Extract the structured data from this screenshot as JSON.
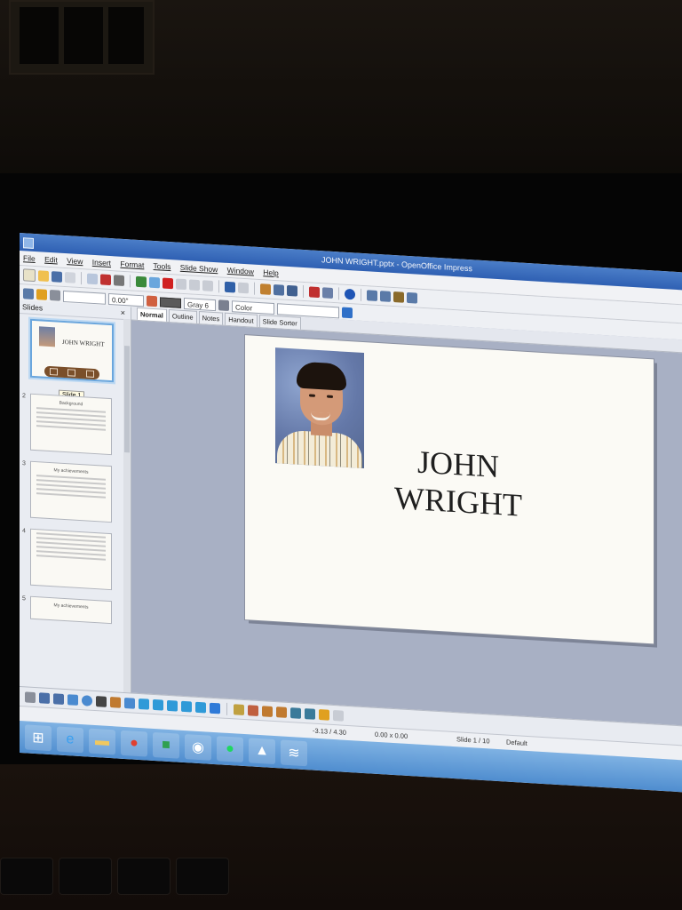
{
  "window": {
    "title": "JOHN WRIGHT.pptx - OpenOffice Impress"
  },
  "menu": [
    "File",
    "Edit",
    "View",
    "Insert",
    "Format",
    "Tools",
    "Slide Show",
    "Window",
    "Help"
  ],
  "format_toolbar": {
    "line_width": "0.00\"",
    "fill_color": "Gray 6",
    "fill_type": "Color"
  },
  "slides_panel": {
    "header": "Slides",
    "close": "×",
    "tooltip": "Slide 1",
    "thumbnails": [
      {
        "number": "",
        "title": "JOHN WRIGHT"
      },
      {
        "number": "2",
        "heading": "Background"
      },
      {
        "number": "3",
        "heading": "My achievements"
      },
      {
        "number": "4",
        "heading": ""
      },
      {
        "number": "5",
        "heading": "My achievements"
      }
    ]
  },
  "view_tabs": [
    "Normal",
    "Outline",
    "Notes",
    "Handout",
    "Slide Sorter"
  ],
  "active_tab": "Normal",
  "slide": {
    "title_line1": "JOHN",
    "title_line2": "WRIGHT"
  },
  "status": {
    "position": "-3.13 / 4.30",
    "size": "0.00 x 0.00",
    "slide_indicator": "Slide 1 / 10",
    "layout": "Default"
  },
  "colors": {
    "titlebar": "#2f60b3",
    "taskbar": "#5b97d6",
    "selection": "#6aa6dd"
  },
  "taskbar_icons": [
    "start-icon",
    "ie-icon",
    "folder-icon",
    "chrome-icon",
    "store-icon",
    "browser-icon",
    "spotify-icon",
    "app-icon",
    "app-icon"
  ]
}
